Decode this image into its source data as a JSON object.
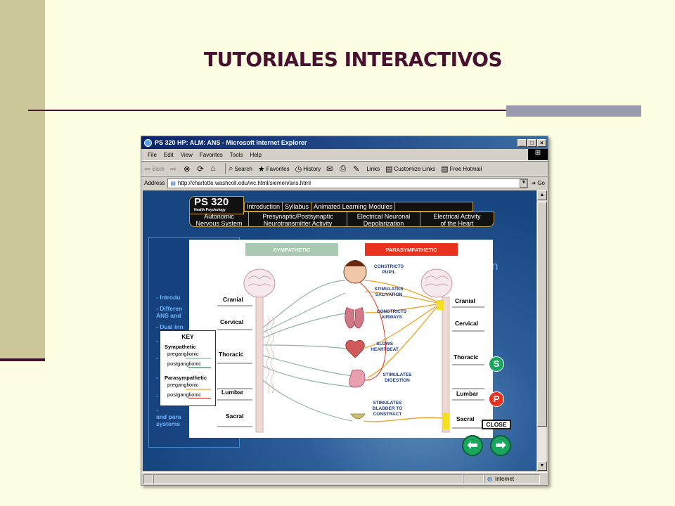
{
  "slide": {
    "title": "TUTORIALES INTERACTIVOS"
  },
  "browser": {
    "window_title": "PS 320 HP: ALM: ANS - Microsoft Internet Explorer",
    "window_buttons": [
      "_",
      "□",
      "×"
    ],
    "menu": [
      "File",
      "Edit",
      "View",
      "Favorites",
      "Tools",
      "Help"
    ],
    "toolbar": {
      "back": "Back",
      "search": "Search",
      "favorites": "Favorites",
      "history": "History",
      "links": "Links",
      "customize_links": "Customize Links",
      "free_hotmail": "Free Hotmail"
    },
    "address_label": "Address",
    "address_value": "http://charlotte.washcoll.edu/wc.html/siemen/ans.html",
    "go_label": "Go",
    "status_zone": "Internet"
  },
  "page": {
    "logo": "PS 320",
    "logo_sub": "Health Psychology",
    "nav_row1": [
      "Introduction",
      "Syllabus",
      "Animated Learning Modules"
    ],
    "nav_row2": [
      {
        "line1": "Autonomic",
        "line2": "Nervous System"
      },
      {
        "line1": "Presynaptic/Postsynaptic",
        "line2": "Neurotransmitter Activity"
      },
      {
        "line1": "Electrical Neuronal",
        "line2": "Depolarization"
      },
      {
        "line1": "Electrical Activity",
        "line2": "of the Heart"
      }
    ],
    "left_panel_lines": [
      "- Introdu",
      "- Differen",
      "ANS and",
      "- Dual inn",
      "-",
      "-",
      "-",
      "-",
      "-",
      "and para",
      "systems"
    ],
    "right_letter": "n"
  },
  "diagram": {
    "sympathetic_label": "SYMPATHETIC",
    "parasympathetic_label": "PARASYMPATHETIC",
    "colors": {
      "sympathetic_header": "#a9c9b3",
      "parasympathetic_header": "#e8321e",
      "sympathetic_line": "#8fb6a4",
      "parasympathetic_line": "#f2a020",
      "spine": "#e4c6be",
      "sacral_highlight": "#f4e020"
    },
    "left_regions": [
      "Cranial",
      "Cervical",
      "Thoracic",
      "Lumbar",
      "Sacral"
    ],
    "right_regions": [
      "Cranial",
      "Cervical",
      "Thoracic",
      "Lumbar",
      "Sacral"
    ],
    "effects": [
      {
        "line1": "CONSTRICTS",
        "line2": "PUPIL",
        "line3": ""
      },
      {
        "line1": "STIMULATES",
        "line2": "SALIVATION",
        "line3": ""
      },
      {
        "line1": "CONSTRICTS",
        "line2": "AIRWAYS",
        "line3": ""
      },
      {
        "line1": "SLOWS",
        "line2": "HEARTBEAT",
        "line3": ""
      },
      {
        "line1": "STIMULATES",
        "line2": "DIGESTION",
        "line3": ""
      },
      {
        "line1": "STIMULATES",
        "line2": "BLADDER TO",
        "line3": "CONSTRACT"
      }
    ],
    "key": {
      "title": "KEY",
      "sympathetic": "Sympathetic",
      "sym_pre": "preganglionic",
      "sym_post": "postganglionic",
      "parasympathetic": "Parasympathetic",
      "para_pre": "preganglionic",
      "para_post": "postganglionic"
    },
    "s_button": "S",
    "p_button": "P",
    "close_label": "CLOSE",
    "prev_arrow": "⬅",
    "next_arrow": "➡"
  }
}
